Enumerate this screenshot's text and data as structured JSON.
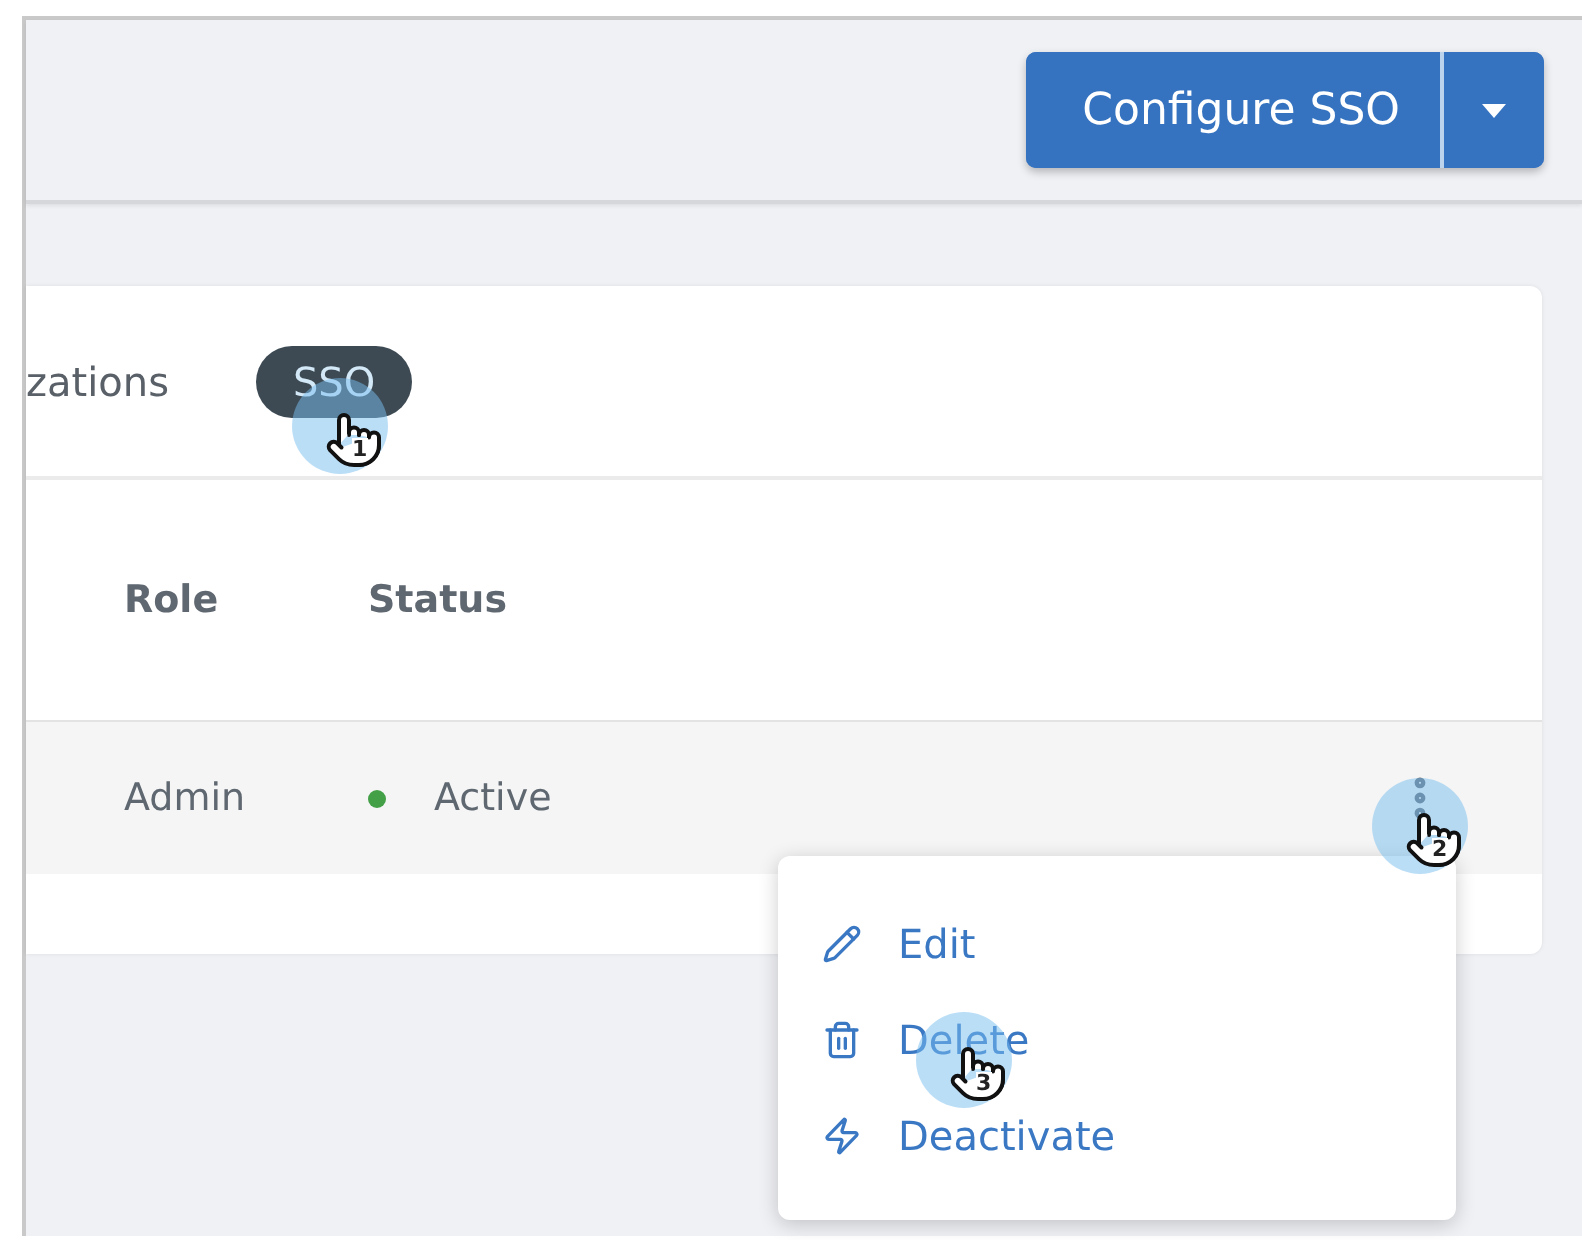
{
  "header": {
    "button": {
      "label": "Configure SSO"
    }
  },
  "tabs": [
    {
      "label": "zations",
      "selected": false
    },
    {
      "label": "SSO",
      "selected": true
    }
  ],
  "table": {
    "columns": [
      "Role",
      "Status"
    ],
    "rows": [
      {
        "role": "Admin",
        "status": "Active",
        "color": "#43a047"
      }
    ]
  },
  "menu": {
    "items": [
      {
        "kind": "edit",
        "label": "Edit"
      },
      {
        "kind": "delete",
        "label": "Delete"
      },
      {
        "kind": "deactivate",
        "label": "Deactivate"
      }
    ]
  },
  "steps": [
    {
      "number": "1"
    },
    {
      "number": "2"
    },
    {
      "number": "3"
    }
  ]
}
